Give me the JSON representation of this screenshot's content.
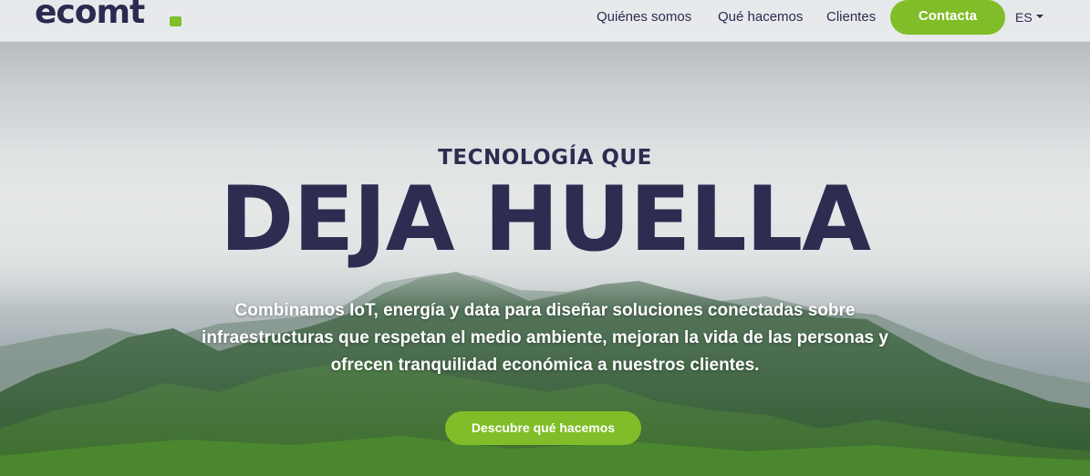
{
  "brand": {
    "logo_text": "ecomt",
    "accent_color": "#80bd28",
    "primary_color": "#2d2a4f"
  },
  "nav": {
    "links": [
      "Quiénes somos",
      "Qué hacemos",
      "Clientes"
    ],
    "contact_label": "Contacta",
    "language": "ES"
  },
  "hero": {
    "eyebrow": "TECNOLOGÍA QUE",
    "headline": "DEJA HUELLA",
    "subtitle_lines": [
      "Combinamos IoT, energía y data para diseñar soluciones conectadas sobre",
      "infraestructuras que respetan el medio ambiente, mejoran la vida de las personas y",
      "ofrecen tranquilidad económica a nuestros clientes."
    ],
    "cta_label": "Descubre qué hacemos"
  }
}
